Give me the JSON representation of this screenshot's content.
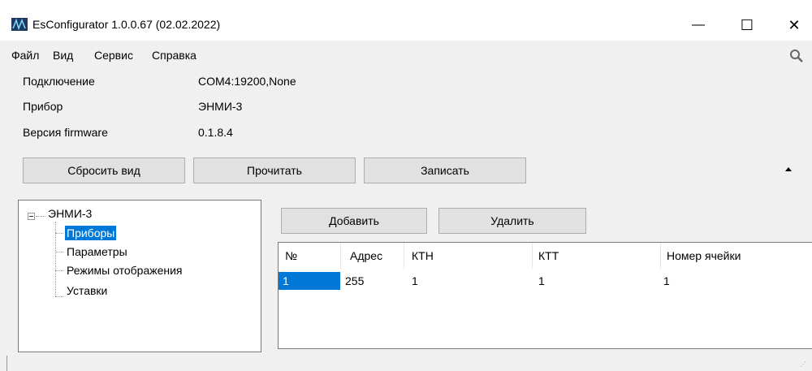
{
  "window": {
    "title": "EsConfigurator 1.0.0.67 (02.02.2022)",
    "minimize_glyph": "—",
    "maximize_glyph": "☐",
    "close_glyph": "✕"
  },
  "menu": {
    "items": [
      {
        "label": "Файл"
      },
      {
        "label": "Вид"
      },
      {
        "label": "Сервис"
      },
      {
        "label": "Справка"
      }
    ]
  },
  "info": {
    "connection_label": "Подключение",
    "connection_value": "COM4:19200,None",
    "device_label": "Прибор",
    "device_value": "ЭНМИ-3",
    "firmware_label": "Версия firmware",
    "firmware_value": "0.1.8.4"
  },
  "toolbar": {
    "reset_view": "Сбросить вид",
    "read": "Прочитать",
    "write": "Записать"
  },
  "tree": {
    "root": "ЭНМИ-3",
    "children": [
      {
        "label": "Приборы",
        "selected": true
      },
      {
        "label": "Параметры",
        "selected": false
      },
      {
        "label": "Режимы отображения",
        "selected": false
      },
      {
        "label": "Уставки",
        "selected": false
      }
    ]
  },
  "actions": {
    "add": "Добавить",
    "delete": "Удалить"
  },
  "table": {
    "columns": [
      "№",
      "Адрес",
      "КТН",
      "КТТ",
      "Номер ячейки"
    ],
    "rows": [
      [
        "1",
        "255",
        "1",
        "1",
        "1"
      ]
    ]
  },
  "colors": {
    "selection": "#0078d7",
    "background": "#f0f0f0",
    "button": "#e1e1e1"
  }
}
